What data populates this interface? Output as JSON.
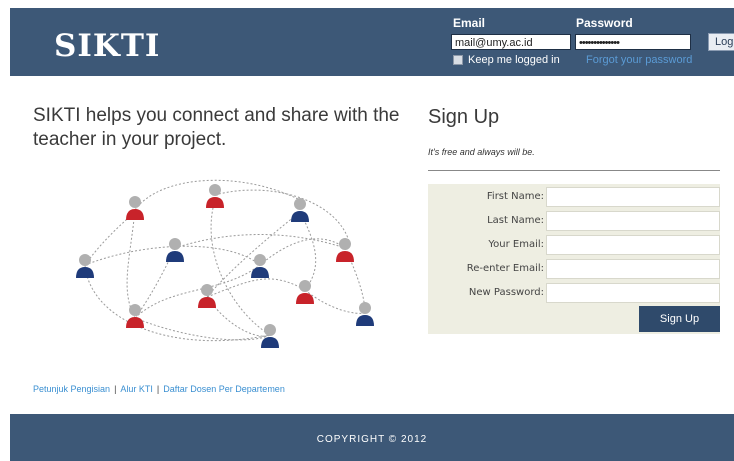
{
  "header": {
    "logo": "SIKTI",
    "email_label": "Email",
    "email_value": "mail@umy.ac.id",
    "password_label": "Password",
    "password_value": "••••••••••••••",
    "login_label": "Log In",
    "keep_logged_in": "Keep me logged in",
    "forgot_password": "Forgot your password"
  },
  "main": {
    "tagline": "SIKTI helps you connect and share with the teacher in your project."
  },
  "signup": {
    "title": "Sign Up",
    "subtitle": "It's free and always will be.",
    "fields": [
      {
        "label": "First Name:"
      },
      {
        "label": "Last Name:"
      },
      {
        "label": "Your Email:"
      },
      {
        "label": "Re-enter Email:"
      },
      {
        "label": "New Password:"
      }
    ],
    "button": "Sign Up"
  },
  "footer_links": [
    "Petunjuk Pengisian",
    "Alur KTI",
    "Daftar Dosen Per Departemen"
  ],
  "footer": {
    "copyright": "COPYRIGHT © 2012"
  },
  "colors": {
    "header_bg": "#3d5877",
    "person_red": "#c8232a",
    "person_blue": "#1f3b7a",
    "link": "#3a8fd1"
  }
}
